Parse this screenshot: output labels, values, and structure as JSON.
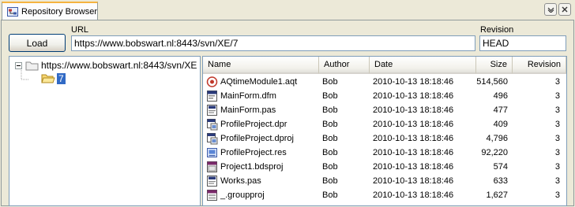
{
  "tab": {
    "label": "Repository Browser"
  },
  "toolbar": {
    "load_label": "Load"
  },
  "url": {
    "label": "URL",
    "value": "https://www.bobswart.nl:8443/svn/XE/7"
  },
  "revision": {
    "label": "Revision",
    "value": "HEAD"
  },
  "tree": {
    "root": "https://www.bobswart.nl:8443/svn/XE",
    "child": "7"
  },
  "list": {
    "columns": {
      "name": "Name",
      "author": "Author",
      "date": "Date",
      "size": "Size",
      "revision": "Revision"
    },
    "rows": [
      {
        "name": "AQtimeModule1.aqt",
        "author": "Bob",
        "date": "2010-10-13 18:18:46",
        "size": "514,560",
        "revision": "3",
        "icon": "aqt-file-icon"
      },
      {
        "name": "MainForm.dfm",
        "author": "Bob",
        "date": "2010-10-13 18:18:46",
        "size": "496",
        "revision": "3",
        "icon": "dfm-file-icon"
      },
      {
        "name": "MainForm.pas",
        "author": "Bob",
        "date": "2010-10-13 18:18:46",
        "size": "477",
        "revision": "3",
        "icon": "pas-file-icon"
      },
      {
        "name": "ProfileProject.dpr",
        "author": "Bob",
        "date": "2010-10-13 18:18:46",
        "size": "409",
        "revision": "3",
        "icon": "dpr-file-icon"
      },
      {
        "name": "ProfileProject.dproj",
        "author": "Bob",
        "date": "2010-10-13 18:18:46",
        "size": "4,796",
        "revision": "3",
        "icon": "dproj-file-icon"
      },
      {
        "name": "ProfileProject.res",
        "author": "Bob",
        "date": "2010-10-13 18:18:46",
        "size": "92,220",
        "revision": "3",
        "icon": "res-file-icon"
      },
      {
        "name": "Project1.bdsproj",
        "author": "Bob",
        "date": "2010-10-13 18:18:46",
        "size": "574",
        "revision": "3",
        "icon": "bdsproj-file-icon"
      },
      {
        "name": "Works.pas",
        "author": "Bob",
        "date": "2010-10-13 18:18:46",
        "size": "633",
        "revision": "3",
        "icon": "pas-file-icon"
      },
      {
        "name": "_.groupproj",
        "author": "Bob",
        "date": "2010-10-13 18:18:46",
        "size": "1,627",
        "revision": "3",
        "icon": "groupproj-file-icon"
      }
    ]
  },
  "colors": {
    "selection": "#316ac5",
    "tab_accent": "#f5b340",
    "border": "#7f9db9"
  }
}
